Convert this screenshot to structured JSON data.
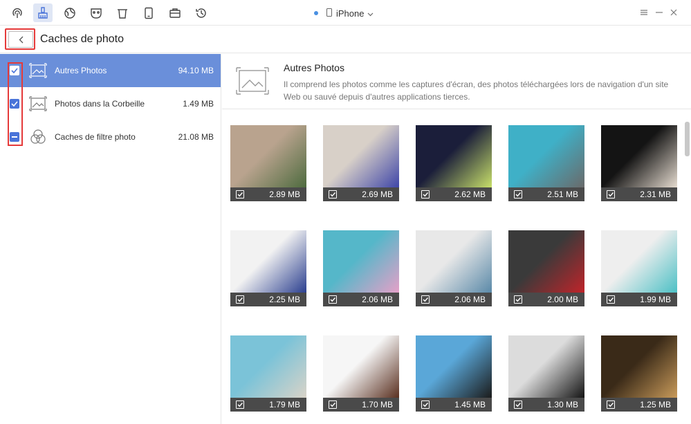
{
  "toolbar": {
    "icons": [
      "content-manager-icon",
      "cleaner-icon",
      "internet-icon",
      "privacy-mask-icon",
      "trash-bin-icon",
      "tablet-icon",
      "toolbox-icon",
      "history-icon"
    ],
    "device_name": "iPhone"
  },
  "header": {
    "title": "Caches de photo"
  },
  "sidebar": {
    "items": [
      {
        "label": "Autres Photos",
        "size": "94.10 MB",
        "state": "checked",
        "selected": true
      },
      {
        "label": "Photos dans la Corbeille",
        "size": "1.49 MB",
        "state": "checked",
        "selected": false
      },
      {
        "label": "Caches de filtre photo",
        "size": "21.08 MB",
        "state": "partial",
        "selected": false
      }
    ]
  },
  "info": {
    "title": "Autres Photos",
    "description": "Il comprend les photos comme les captures d'écran, des photos téléchargées lors de navigation d'un site Web ou sauvé depuis d'autres applications tierces."
  },
  "photos": [
    {
      "size": "2.89 MB",
      "colors": [
        "#b9a38e",
        "#4e6b3f"
      ]
    },
    {
      "size": "2.69 MB",
      "colors": [
        "#d8d0c8",
        "#3f46a8"
      ]
    },
    {
      "size": "2.62 MB",
      "colors": [
        "#1b1e3a",
        "#c8e06a"
      ]
    },
    {
      "size": "2.51 MB",
      "colors": [
        "#3fb0c7",
        "#6a6a6a"
      ]
    },
    {
      "size": "2.31 MB",
      "colors": [
        "#141414",
        "#e6dcd0"
      ]
    },
    {
      "size": "2.25 MB",
      "colors": [
        "#f2f2f2",
        "#2b3f8f"
      ]
    },
    {
      "size": "2.06 MB",
      "colors": [
        "#55b7c9",
        "#e5a0c8"
      ]
    },
    {
      "size": "2.06 MB",
      "colors": [
        "#e8e8e8",
        "#5a89a8"
      ]
    },
    {
      "size": "2.00 MB",
      "colors": [
        "#3a3a3a",
        "#c0242a"
      ]
    },
    {
      "size": "1.99 MB",
      "colors": [
        "#eeeeee",
        "#4cc0c5"
      ]
    },
    {
      "size": "1.79 MB",
      "colors": [
        "#7bc3d8",
        "#d9d3c8"
      ]
    },
    {
      "size": "1.70 MB",
      "colors": [
        "#f6f6f6",
        "#5a3020"
      ]
    },
    {
      "size": "1.45 MB",
      "colors": [
        "#5aa7d8",
        "#1b1b1b"
      ]
    },
    {
      "size": "1.30 MB",
      "colors": [
        "#dcdcdc",
        "#141414"
      ]
    },
    {
      "size": "1.25 MB",
      "colors": [
        "#3a2a18",
        "#c89a5a"
      ]
    }
  ]
}
